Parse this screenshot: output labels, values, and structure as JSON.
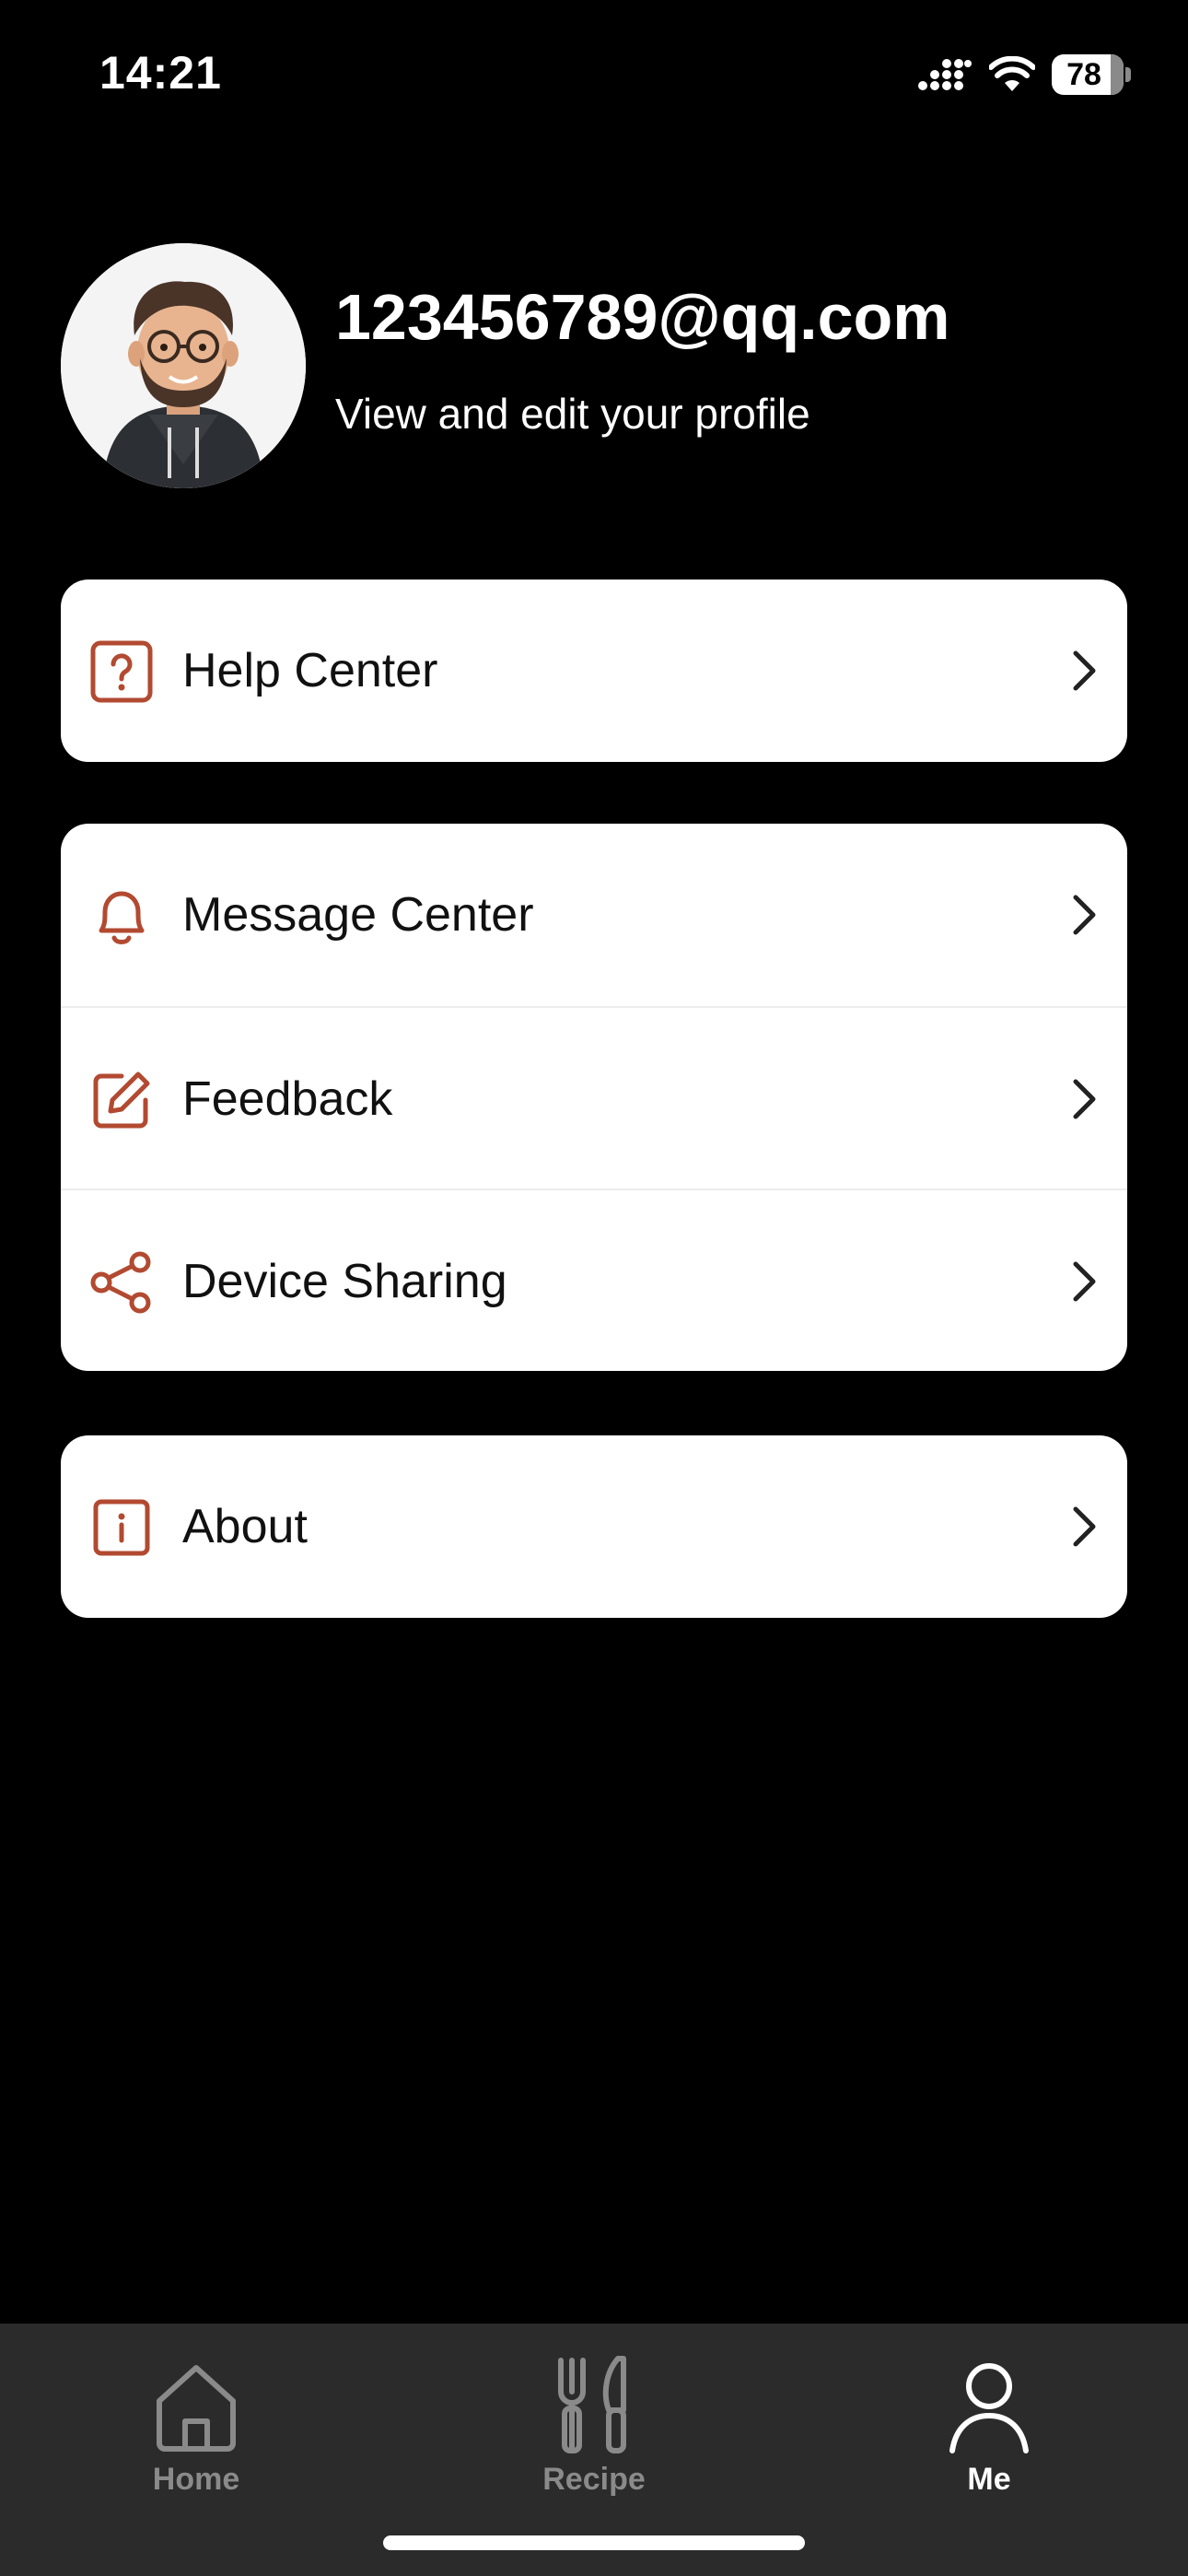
{
  "status_bar": {
    "time": "14:21",
    "battery": "78",
    "icons": [
      "signal-icon",
      "wifi-icon",
      "battery-icon"
    ]
  },
  "profile": {
    "email": "123456789@qq.com",
    "subtitle": "View and edit your profile",
    "avatar": "avatar"
  },
  "groups": [
    {
      "items": [
        {
          "label": "Help Center",
          "icon": "help-icon"
        }
      ]
    },
    {
      "items": [
        {
          "label": "Message Center",
          "icon": "bell-icon"
        },
        {
          "label": "Feedback",
          "icon": "edit-icon"
        },
        {
          "label": "Device Sharing",
          "icon": "share-icon"
        }
      ]
    },
    {
      "items": [
        {
          "label": "About",
          "icon": "info-icon"
        }
      ]
    }
  ],
  "tab_bar": {
    "tabs": [
      {
        "label": "Home",
        "icon": "home-icon",
        "active": false
      },
      {
        "label": "Recipe",
        "icon": "cutlery-icon",
        "active": false
      },
      {
        "label": "Me",
        "icon": "person-icon",
        "active": true
      }
    ]
  },
  "colors": {
    "background": "#000000",
    "accent": "#b24a31",
    "card": "#ffffff",
    "tab_bar": "#2b2b2b",
    "tab_inactive": "#8a8a8a",
    "tab_active": "#ffffff"
  }
}
